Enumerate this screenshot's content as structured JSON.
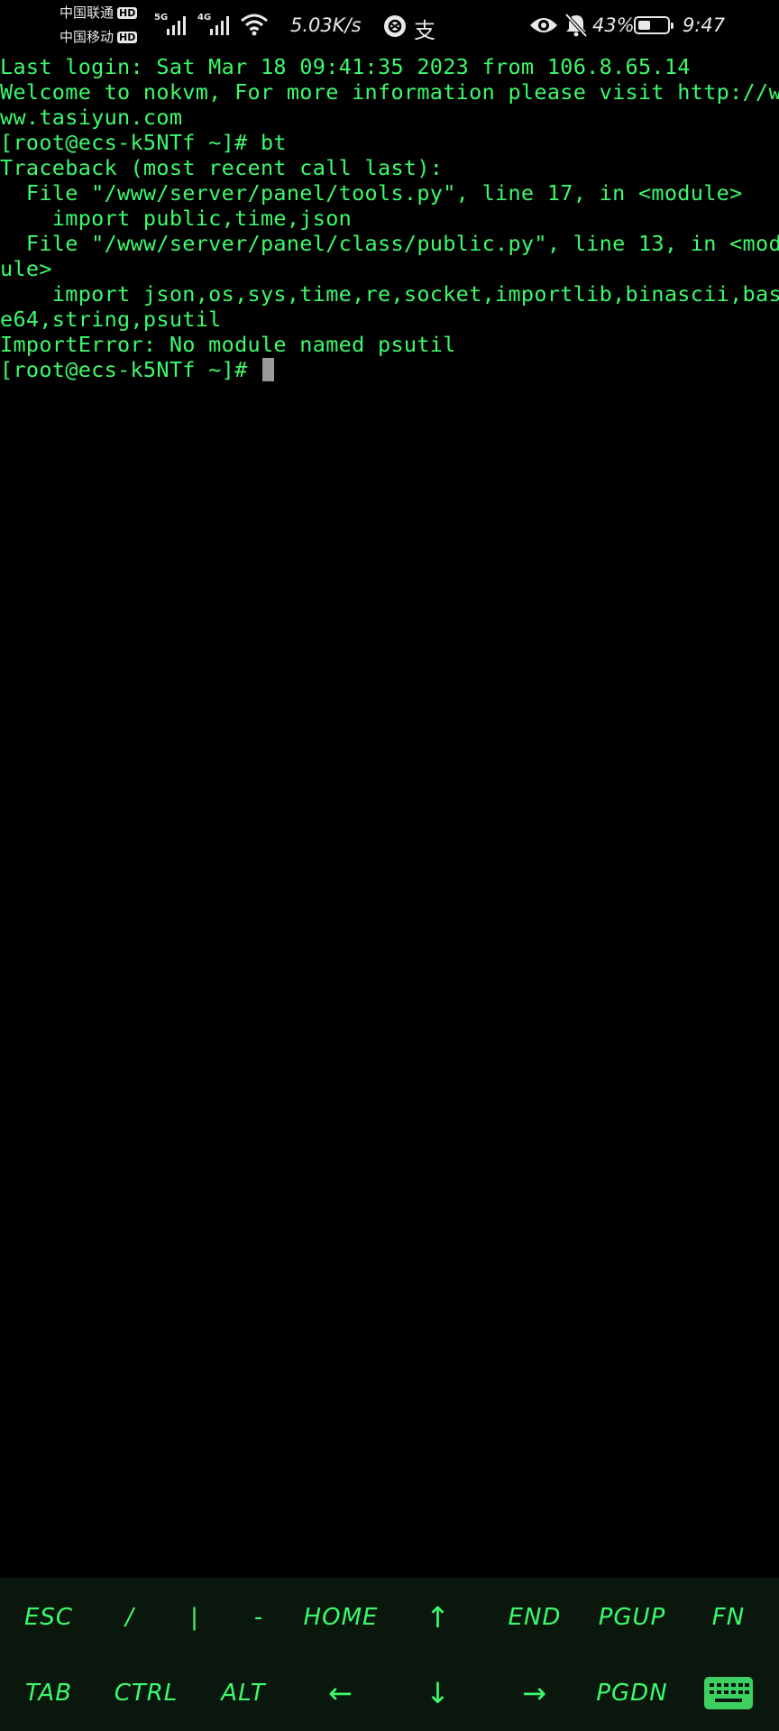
{
  "status_bar": {
    "carrier1": "中国联通",
    "carrier1_badge": "HD",
    "carrier2": "中国移动",
    "carrier2_badge": "HD",
    "net1": "5G",
    "net2": "4G",
    "speed": "5.03K/s",
    "app_icon_2": "支",
    "battery_percent": "43%",
    "battery_level": 0.43,
    "time": "9:47",
    "icons": [
      "signal-icon",
      "wifi-icon",
      "app-notification-icon",
      "eye-icon",
      "bell-off-icon",
      "battery-icon"
    ]
  },
  "terminal": {
    "lines": [
      "Last login: Sat Mar 18 09:41:35 2023 from 106.8.65.14",
      "Welcome to nokvm, For more information please visit http://w",
      "ww.tasiyun.com",
      "[root@ecs-k5NTf ~]# bt",
      "Traceback (most recent call last):",
      "  File \"/www/server/panel/tools.py\", line 17, in <module>",
      "    import public,time,json",
      "  File \"/www/server/panel/class/public.py\", line 13, in <mod",
      "ule>",
      "    import json,os,sys,time,re,socket,importlib,binascii,bas",
      "e64,string,psutil",
      "ImportError: No module named psutil"
    ],
    "prompt": "[root@ecs-k5NTf ~]# ",
    "colors": {
      "text": "#3dfa6c",
      "background": "#000000",
      "cursor": "#9a9a9a"
    }
  },
  "extra_keys": {
    "row1": [
      "ESC",
      "/",
      "|",
      "-",
      "HOME",
      "↑",
      "END",
      "PGUP",
      "FN"
    ],
    "row2": [
      "TAB",
      "CTRL",
      "ALT",
      "←",
      "↓",
      "→",
      "PGDN"
    ],
    "keyboard_toggle_icon": "keyboard-icon",
    "colors": {
      "key_text": "#3dfa6c",
      "background": "#09170d"
    }
  }
}
